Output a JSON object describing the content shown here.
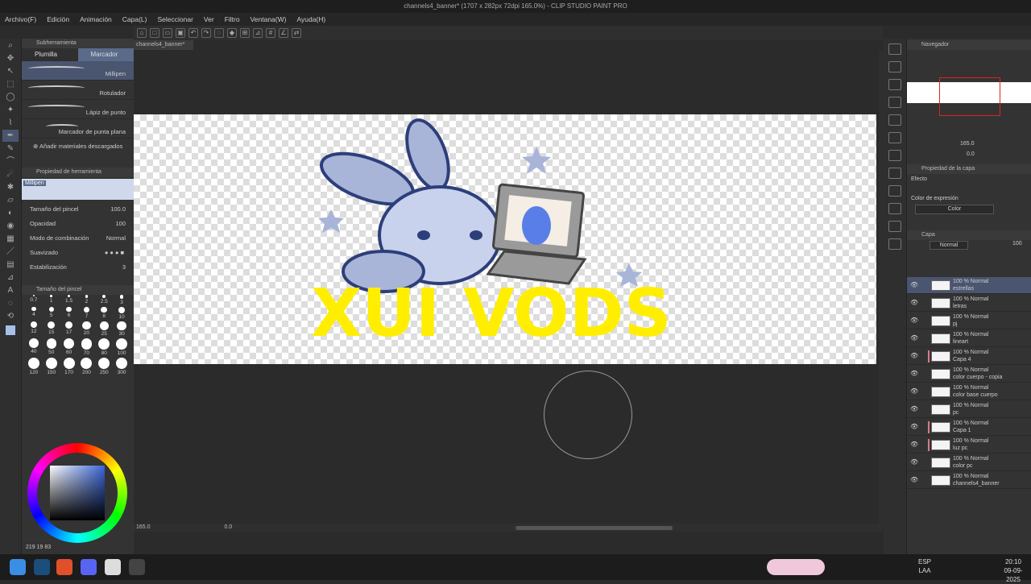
{
  "window": {
    "title": "channels4_banner* (1707 x 282px 72dpi 165.0%) - CLIP STUDIO PAINT PRO"
  },
  "menu": [
    "Archivo(F)",
    "Edición",
    "Animación",
    "Capa(L)",
    "Seleccionar",
    "Ver",
    "Filtro",
    "Ventana(W)",
    "Ayuda(H)"
  ],
  "document_tab": "channels4_banner*",
  "subtool": {
    "panel_title": "Subherramienta",
    "tabs": [
      "Plumilla",
      "Marcador"
    ],
    "brushes": [
      "Millipen",
      "Rotulador",
      "Lápiz de punto",
      "Marcador de punta plana"
    ],
    "add_materials": "Añadir materiales descargados"
  },
  "tool_property": {
    "panel_title": "Propiedad de herramienta",
    "preview_label": "Millipen",
    "rows": [
      {
        "label": "Tamaño del pincel",
        "value": "100.0"
      },
      {
        "label": "Opacidad",
        "value": "100"
      },
      {
        "label": "Modo de combinación",
        "value": "Normal"
      },
      {
        "label": "Suavizado",
        "value": ""
      },
      {
        "label": "Estabilización",
        "value": "3"
      }
    ]
  },
  "brush_size": {
    "panel_title": "Tamaño del pincel",
    "sizes": [
      "0.7",
      "1",
      "1.5",
      "2",
      "2.5",
      "3",
      "4",
      "5",
      "6",
      "7",
      "8",
      "10",
      "12",
      "15",
      "17",
      "20",
      "25",
      "30",
      "40",
      "50",
      "60",
      "70",
      "80",
      "100",
      "120",
      "150",
      "170",
      "200",
      "250",
      "300"
    ]
  },
  "color_readout": "219  19  83",
  "status": {
    "zoom": "165.0",
    "angle": "0.0"
  },
  "navigator": {
    "title": "Navegador",
    "zoom": "165.0",
    "angle": "0.0"
  },
  "layer_property": {
    "title": "Propiedad de la capa",
    "effect": "Efecto",
    "expression_label": "Color de expresión",
    "expression_value": "Color"
  },
  "layers_panel": {
    "title": "Capa",
    "blend": "Normal",
    "opacity": "100",
    "layers": [
      {
        "mode": "100 % Normal",
        "name": "estrellas"
      },
      {
        "mode": "100 % Normal",
        "name": "letras"
      },
      {
        "mode": "100 % Normal",
        "name": "pj"
      },
      {
        "mode": "100 % Normal",
        "name": "lineart"
      },
      {
        "mode": "100 % Normal",
        "name": "Capa 4"
      },
      {
        "mode": "100 % Normal",
        "name": "color cuerpo - copia"
      },
      {
        "mode": "100 % Normal",
        "name": "color base cuerpo"
      },
      {
        "mode": "100 % Normal",
        "name": "pc"
      },
      {
        "mode": "100 % Normal",
        "name": "Capa 1"
      },
      {
        "mode": "100 % Normal",
        "name": "luz pc"
      },
      {
        "mode": "100 % Normal",
        "name": "color pc"
      },
      {
        "mode": "100 % Normal",
        "name": "channels4_banner"
      }
    ]
  },
  "artwork": {
    "text": "XUI VODS",
    "text_color": "#ffee00",
    "bunny_color": "#a8b4d8",
    "outline_color": "#2d3f7a"
  },
  "taskbar": {
    "lang_top": "ESP",
    "lang_bottom": "LAA",
    "time": "20:10",
    "date": "09-09-2025"
  }
}
